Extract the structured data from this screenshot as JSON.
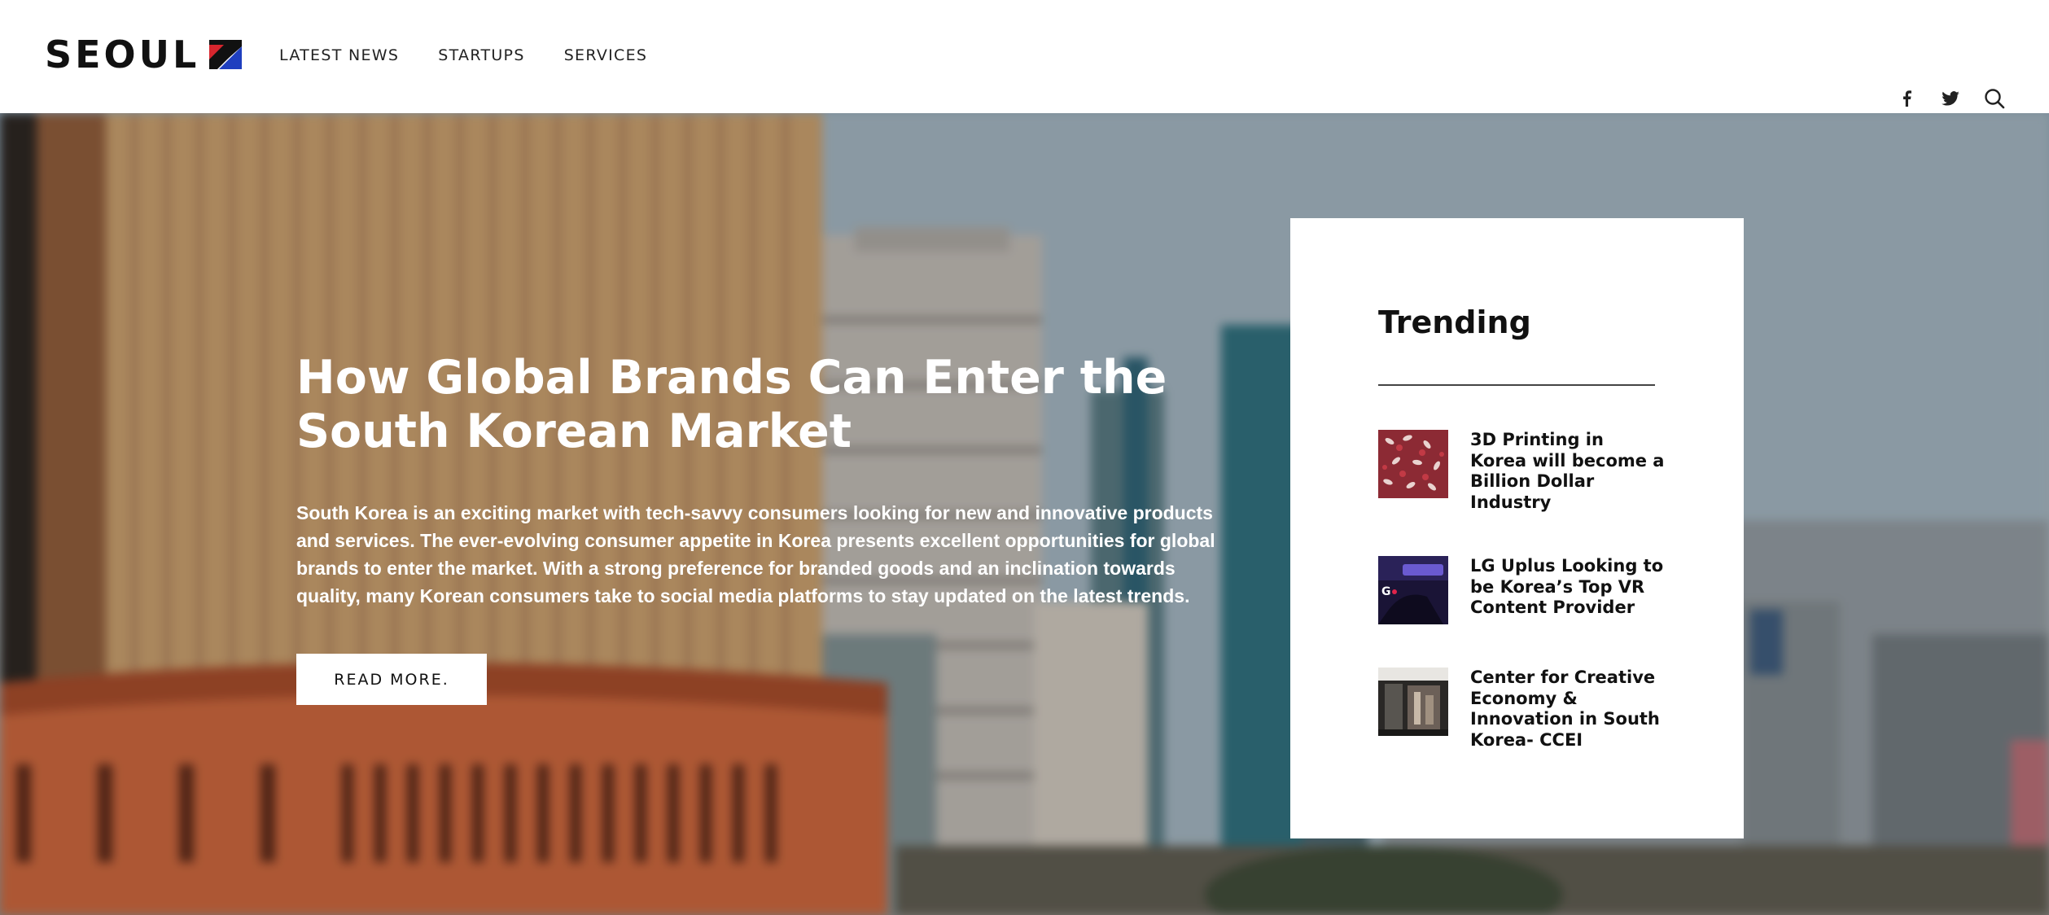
{
  "brand": {
    "logo_text": "SEOUL",
    "accent_red": "#d7262e",
    "accent_blue": "#1f3fbf"
  },
  "nav": {
    "items": [
      {
        "label": "LATEST NEWS"
      },
      {
        "label": "STARTUPS"
      },
      {
        "label": "SERVICES"
      }
    ]
  },
  "header_icons": [
    "facebook-icon",
    "twitter-icon",
    "search-icon"
  ],
  "hero": {
    "title": "How Global Brands Can Enter the South Korean Market",
    "excerpt": "South Korea is an exciting market with tech-savvy consumers looking for new and innovative products and services. The ever-evolving consumer appetite in Korea presents excellent opportunities for global brands to enter the market. With a strong preference for branded goods and an inclination towards quality, many Korean consumers take to social media platforms to stay updated on the latest trends.",
    "button_label": "READ MORE."
  },
  "trending": {
    "title": "Trending",
    "items": [
      {
        "title": "3D Printing in Korea will become a Billion Dollar Industry"
      },
      {
        "title": "LG Uplus Looking to be Korea’s Top VR Content Provider"
      },
      {
        "title": "Center for Creative Economy & Innovation in South Korea- CCEI"
      }
    ]
  }
}
